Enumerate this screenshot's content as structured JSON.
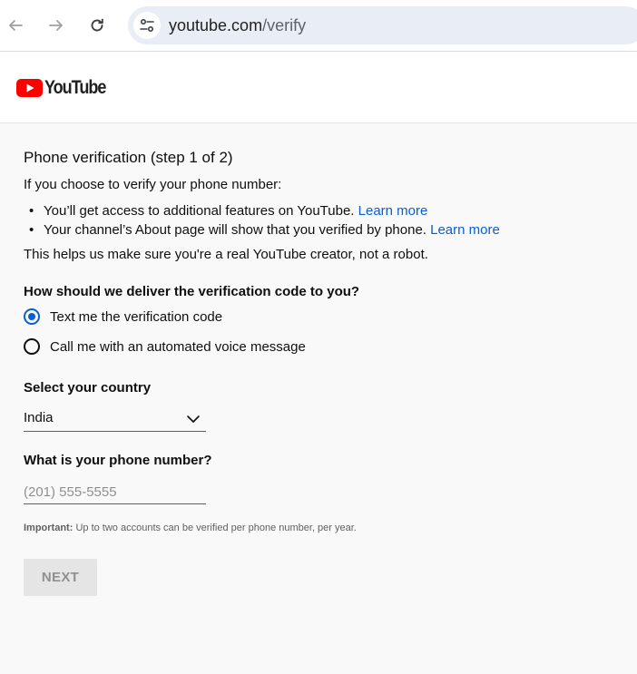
{
  "browser": {
    "url_host": "youtube.com",
    "url_path": "/verify"
  },
  "header": {
    "logo_text": "YouTube"
  },
  "verify": {
    "title": "Phone verification (step 1 of 2)",
    "intro": "If you choose to verify your phone number:",
    "bullets": [
      {
        "text": "You’ll get access to additional features on YouTube. ",
        "link": "Learn more"
      },
      {
        "text": "Your channel’s About page will show that you verified by phone. ",
        "link": "Learn more"
      }
    ],
    "robot_note": "This helps us make sure you're a real YouTube creator, not a robot.",
    "deliver_question": "How should we deliver the verification code to you?",
    "options": [
      {
        "label": "Text me the verification code",
        "checked": true
      },
      {
        "label": "Call me with an automated voice message",
        "checked": false
      }
    ],
    "country_label": "Select your country",
    "country_value": "India",
    "phone_label": "What is your phone number?",
    "phone_placeholder": "(201) 555-5555",
    "phone_value": "",
    "important_label": "Important:",
    "important_text": " Up to two accounts can be verified per phone number, per year.",
    "next_label": "NEXT"
  },
  "colors": {
    "brand_red": "#ff0000",
    "link_blue": "#065fd4",
    "button_disabled_bg": "#e5e5e5",
    "button_disabled_text": "#909090"
  }
}
